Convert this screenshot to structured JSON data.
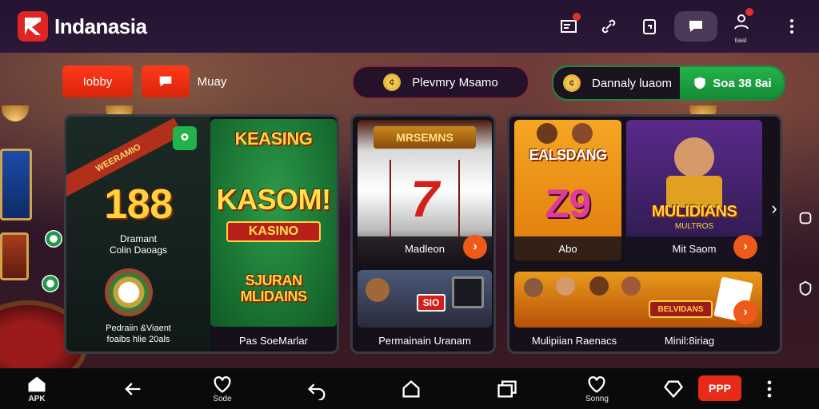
{
  "app": {
    "name": "Indanasia"
  },
  "filters": {
    "lobby_label": "Iobby",
    "second_label": "Muay",
    "center_label": "Plevmry  Msamo",
    "right_label": "Dannaly luaom",
    "right_action": "Soa 38 8ai"
  },
  "panel_left": {
    "ribbon": "WEERAMIO",
    "jackpot_value": "188",
    "jackpot_label_1": "Dramant",
    "jackpot_label_2": "Colin Daoags",
    "bonus_label_1": "Pedraiin &Viaent",
    "bonus_label_2": "foaibs hlie 20als",
    "featured_title_1": "KEASING",
    "featured_title_2": "KASOM!",
    "featured_subtitle": "KASINO",
    "featured_bottom_1": "SJURAN",
    "featured_bottom_2": "MLIDAINS",
    "featured_caption": "Pas SoeMarlar"
  },
  "panel_middle": {
    "slot_banner": "MRSEMNS",
    "slot_number": "7",
    "slot_caption": "Madleon",
    "card_caption": "Permainain Uranam",
    "sign": "SIO"
  },
  "panel_right": {
    "card1_title_1": "EALSDANG",
    "card1_number": "Z9",
    "card1_caption": "Abo",
    "card2_title": "MULIDIANS",
    "card2_subtitle": "MULTROS",
    "card2_caption": "Mit Saom",
    "card3_caption": "Mulipiian Raenacs",
    "card3_sign": "BELVIDANS",
    "card4_caption": "Minil:8iriag"
  },
  "bottom_nav": {
    "apk": "APK",
    "save": "Sode",
    "saving": "Sonng",
    "ppp": "PPP"
  },
  "top": {
    "profile_label": "tiaat"
  },
  "colors": {
    "accent_red": "#e82a18",
    "accent_green": "#1c8a3c",
    "accent_orange": "#f05a18"
  }
}
